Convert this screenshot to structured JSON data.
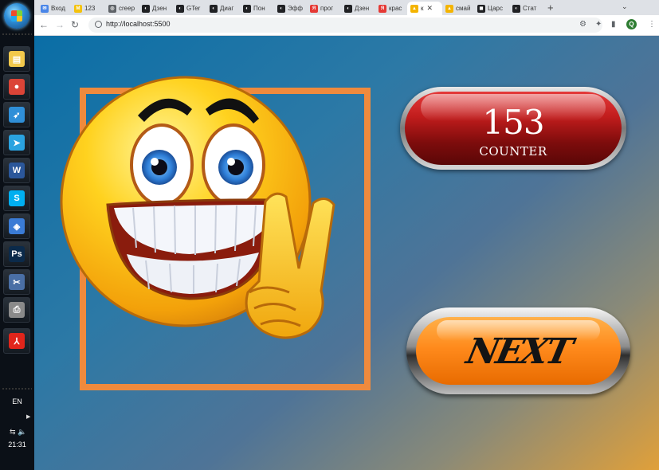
{
  "taskbar": {
    "language": "EN",
    "clock": "21:31",
    "apps": [
      {
        "icon": "file-manager-icon",
        "glyph": "▤",
        "color": "#f2c94c"
      },
      {
        "icon": "chrome-icon",
        "glyph": "●",
        "color": "#db4437"
      },
      {
        "icon": "flight-app-icon",
        "glyph": "➶",
        "color": "#2f8fd8"
      },
      {
        "icon": "telegram-icon",
        "glyph": "➤",
        "color": "#2aa3e0"
      },
      {
        "icon": "word-icon",
        "glyph": "W",
        "color": "#2b579a"
      },
      {
        "icon": "skype-icon",
        "glyph": "S",
        "color": "#00aff0"
      },
      {
        "icon": "kompas-icon",
        "glyph": "◈",
        "color": "#3a7bd5"
      },
      {
        "icon": "photoshop-icon",
        "glyph": "Ps",
        "color": "#0b2a4a"
      },
      {
        "icon": "tools-icon",
        "glyph": "✂",
        "color": "#4a6fa5"
      },
      {
        "icon": "printer-icon",
        "glyph": "⎙",
        "color": "#8a8a8a"
      },
      {
        "icon": "acrobat-icon",
        "glyph": "⅄",
        "color": "#e1251b"
      }
    ]
  },
  "browser": {
    "tabs": [
      {
        "title": "Вход",
        "color": "#4a86e8",
        "glyph": "✉"
      },
      {
        "title": "123",
        "color": "#f4c20d",
        "glyph": "M"
      },
      {
        "title": "creep",
        "color": "#5f6368",
        "glyph": "◎"
      },
      {
        "title": "Дзен",
        "color": "#202124",
        "glyph": "◐"
      },
      {
        "title": "GTer",
        "color": "#202124",
        "glyph": "◐"
      },
      {
        "title": "Диаг",
        "color": "#202124",
        "glyph": "◐"
      },
      {
        "title": "Пон",
        "color": "#202124",
        "glyph": "◐"
      },
      {
        "title": "Эфф",
        "color": "#202124",
        "glyph": "◐"
      },
      {
        "title": "прог",
        "color": "#e53935",
        "glyph": "Я"
      },
      {
        "title": "Дзен",
        "color": "#202124",
        "glyph": "◐"
      },
      {
        "title": "крас",
        "color": "#e53935",
        "glyph": "Я"
      },
      {
        "title": "к",
        "color": "#f4b400",
        "glyph": "▲"
      },
      {
        "title": "смай",
        "color": "#f4b400",
        "glyph": "▲"
      },
      {
        "title": "Царс",
        "color": "#202124",
        "glyph": "◼"
      },
      {
        "title": "Стат",
        "color": "#202124",
        "glyph": "◐"
      }
    ],
    "active_tab_index": 11,
    "url": "http://localhost:5500"
  },
  "page": {
    "counter_value": "153",
    "counter_label": "COUNTER",
    "next_label": "NEXT",
    "frame_color": "#ef8a3d",
    "counter_color": "#c01c1c",
    "next_color": "#ff8a1c"
  }
}
